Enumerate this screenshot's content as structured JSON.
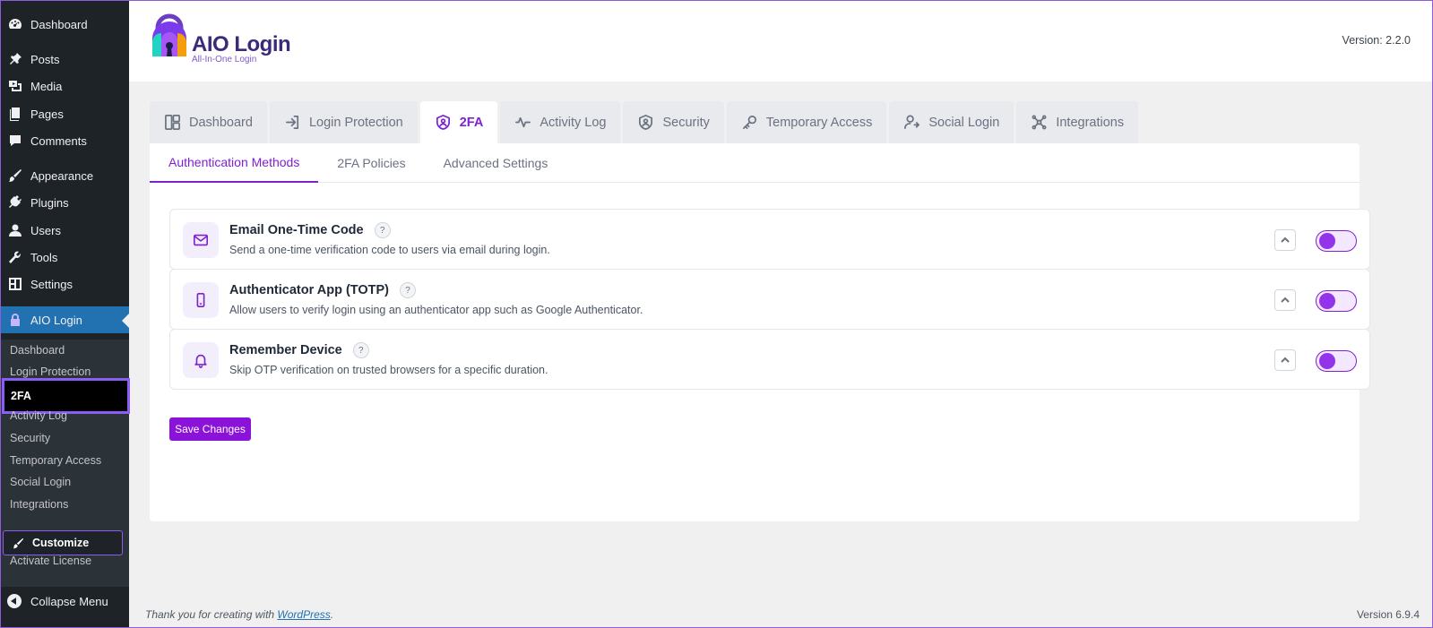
{
  "sidebar": {
    "items": [
      {
        "label": "Dashboard",
        "icon": "dashboard-icon"
      },
      {
        "label": "Posts",
        "icon": "pin-icon"
      },
      {
        "label": "Media",
        "icon": "media-icon"
      },
      {
        "label": "Pages",
        "icon": "pages-icon"
      },
      {
        "label": "Comments",
        "icon": "comment-icon"
      },
      {
        "label": "Appearance",
        "icon": "brush-icon"
      },
      {
        "label": "Plugins",
        "icon": "plugin-icon"
      },
      {
        "label": "Users",
        "icon": "user-icon"
      },
      {
        "label": "Tools",
        "icon": "wrench-icon"
      },
      {
        "label": "Settings",
        "icon": "settings-icon"
      },
      {
        "label": "AIO Login",
        "icon": "aio-logo-icon"
      }
    ],
    "submenu": [
      "Dashboard",
      "Login Protection",
      "2FA",
      "Activity Log",
      "Security",
      "Temporary Access",
      "Social Login",
      "Integrations"
    ],
    "customize_label": "Customize",
    "activate_label": "Activate License",
    "collapse_label": "Collapse Menu"
  },
  "header": {
    "logo_title": "AIO Login",
    "logo_subtitle": "All-In-One Login",
    "version": "Version: 2.2.0"
  },
  "tabs": [
    {
      "label": "Dashboard",
      "icon": "layout-icon"
    },
    {
      "label": "Login Protection",
      "icon": "login-icon"
    },
    {
      "label": "2FA",
      "icon": "shield-user-icon",
      "active": true
    },
    {
      "label": "Activity Log",
      "icon": "activity-icon"
    },
    {
      "label": "Security",
      "icon": "shield-icon"
    },
    {
      "label": "Temporary Access",
      "icon": "key-icon"
    },
    {
      "label": "Social Login",
      "icon": "user-share-icon"
    },
    {
      "label": "Integrations",
      "icon": "integrations-icon"
    }
  ],
  "subtabs": [
    "Authentication Methods",
    "2FA Policies",
    "Advanced Settings"
  ],
  "methods": [
    {
      "title": "Email One-Time Code",
      "desc": "Send a one-time verification code to users via email during login.",
      "icon": "mail-icon",
      "enabled": true
    },
    {
      "title": "Authenticator App (TOTP)",
      "desc": "Allow users to verify login using an authenticator app such as Google Authenticator.",
      "icon": "phone-icon",
      "enabled": true
    },
    {
      "title": "Remember Device",
      "desc": "Skip OTP verification on trusted browsers for a specific duration.",
      "icon": "bell-icon",
      "enabled": true
    }
  ],
  "help_glyph": "?",
  "save_label": "Save Changes",
  "footer": {
    "thanks_prefix": "Thank you for creating with ",
    "wordpress_link": "WordPress",
    "thanks_suffix": ".",
    "version": "Version 6.9.4"
  },
  "colors": {
    "accent": "#7e22ce",
    "sidebar_bg": "#1d2327",
    "active_menu": "#2271b1"
  }
}
